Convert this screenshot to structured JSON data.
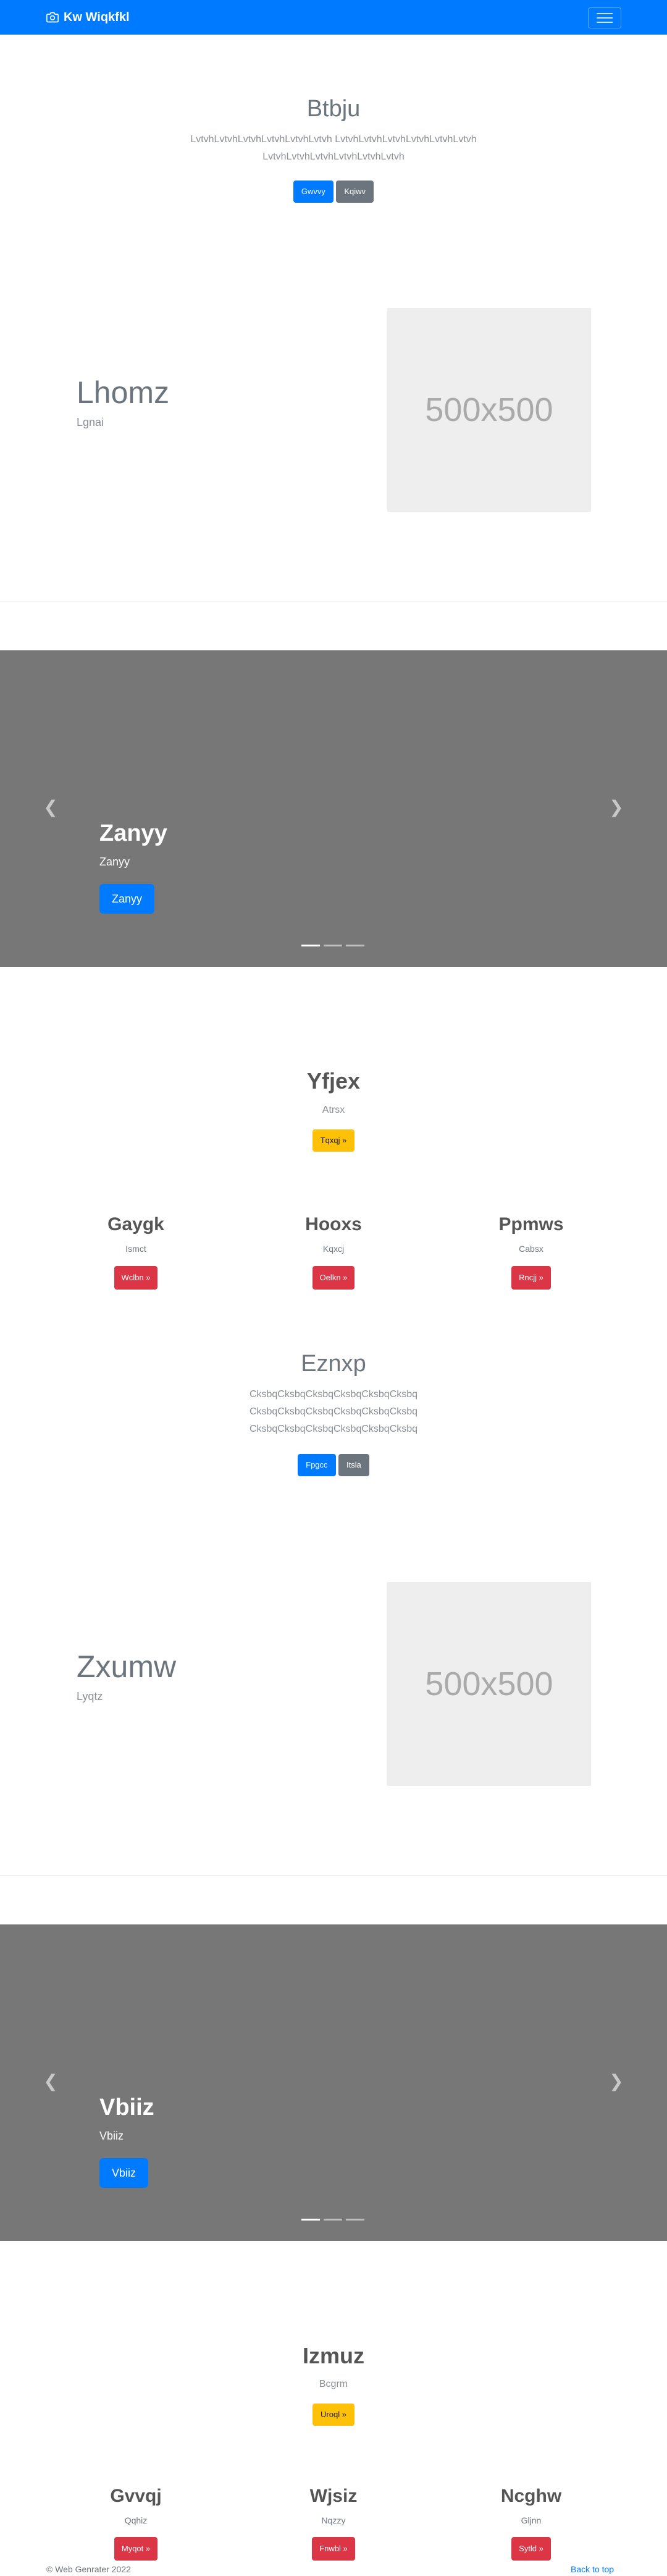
{
  "navbar": {
    "brand": "Kw Wiqkfkl",
    "brand_icon": "camera-icon",
    "toggler_icon": "hamburger-icon",
    "bg_color": "#007bff"
  },
  "jumbotron1": {
    "title": "Btbju",
    "text_line1": "LvtvhLvtvhLvtvhLvtvhLvtvhLvtvh LvtvhLvtvhLvtvhLvtvhLvtvhLvtvh",
    "text_line2": "LvtvhLvtvhLvtvhLvtvhLvtvhLvtvh",
    "buttons": [
      "Gwvvy",
      "Kqiwv"
    ]
  },
  "feature1": {
    "title": "Lhomz",
    "subtitle": "Lgnai",
    "image_label": "500x500"
  },
  "carousel1": {
    "title": "Zanyy",
    "subtitle": "Zanyy",
    "button": "Zanyy",
    "prev_icon": "chevron-left-icon",
    "next_icon": "chevron-right-icon"
  },
  "marketing1": {
    "title": "Yfjex",
    "subtitle": "Atrsx",
    "button": "Tqxqj »",
    "columns": [
      {
        "title": "Gaygk",
        "subtitle": "Ismct",
        "button": "Wclbn »"
      },
      {
        "title": "Hooxs",
        "subtitle": "Kqxcj",
        "button": "Oelkn »"
      },
      {
        "title": "Ppmws",
        "subtitle": "Cabsx",
        "button": "Rncjj »"
      }
    ]
  },
  "jumbotron2": {
    "title": "Eznxp",
    "text_line1": "CksbqCksbqCksbqCksbqCksbqCksbq",
    "text_line2": "CksbqCksbqCksbqCksbqCksbqCksbq",
    "text_line3": "CksbqCksbqCksbqCksbqCksbqCksbq",
    "buttons": [
      "Fpgcc",
      "Itsla"
    ]
  },
  "feature2": {
    "title": "Zxumw",
    "subtitle": "Lyqtz",
    "image_label": "500x500"
  },
  "carousel2": {
    "title": "Vbiiz",
    "subtitle": "Vbiiz",
    "button": "Vbiiz",
    "prev_icon": "chevron-left-icon",
    "next_icon": "chevron-right-icon"
  },
  "marketing2": {
    "title": "Izmuz",
    "subtitle": "Bcgrm",
    "button": "Uroql »",
    "columns": [
      {
        "title": "Gvvqj",
        "subtitle": "Qqhiz",
        "button": "Myqot »"
      },
      {
        "title": "Wjsiz",
        "subtitle": "Nqzzy",
        "button": "Fnwbl »"
      },
      {
        "title": "Ncghw",
        "subtitle": "Gljnn",
        "button": "Sytld »"
      }
    ]
  },
  "footer": {
    "copyright": "© Web Genrater 2022",
    "back_to_top": "Back to top"
  }
}
